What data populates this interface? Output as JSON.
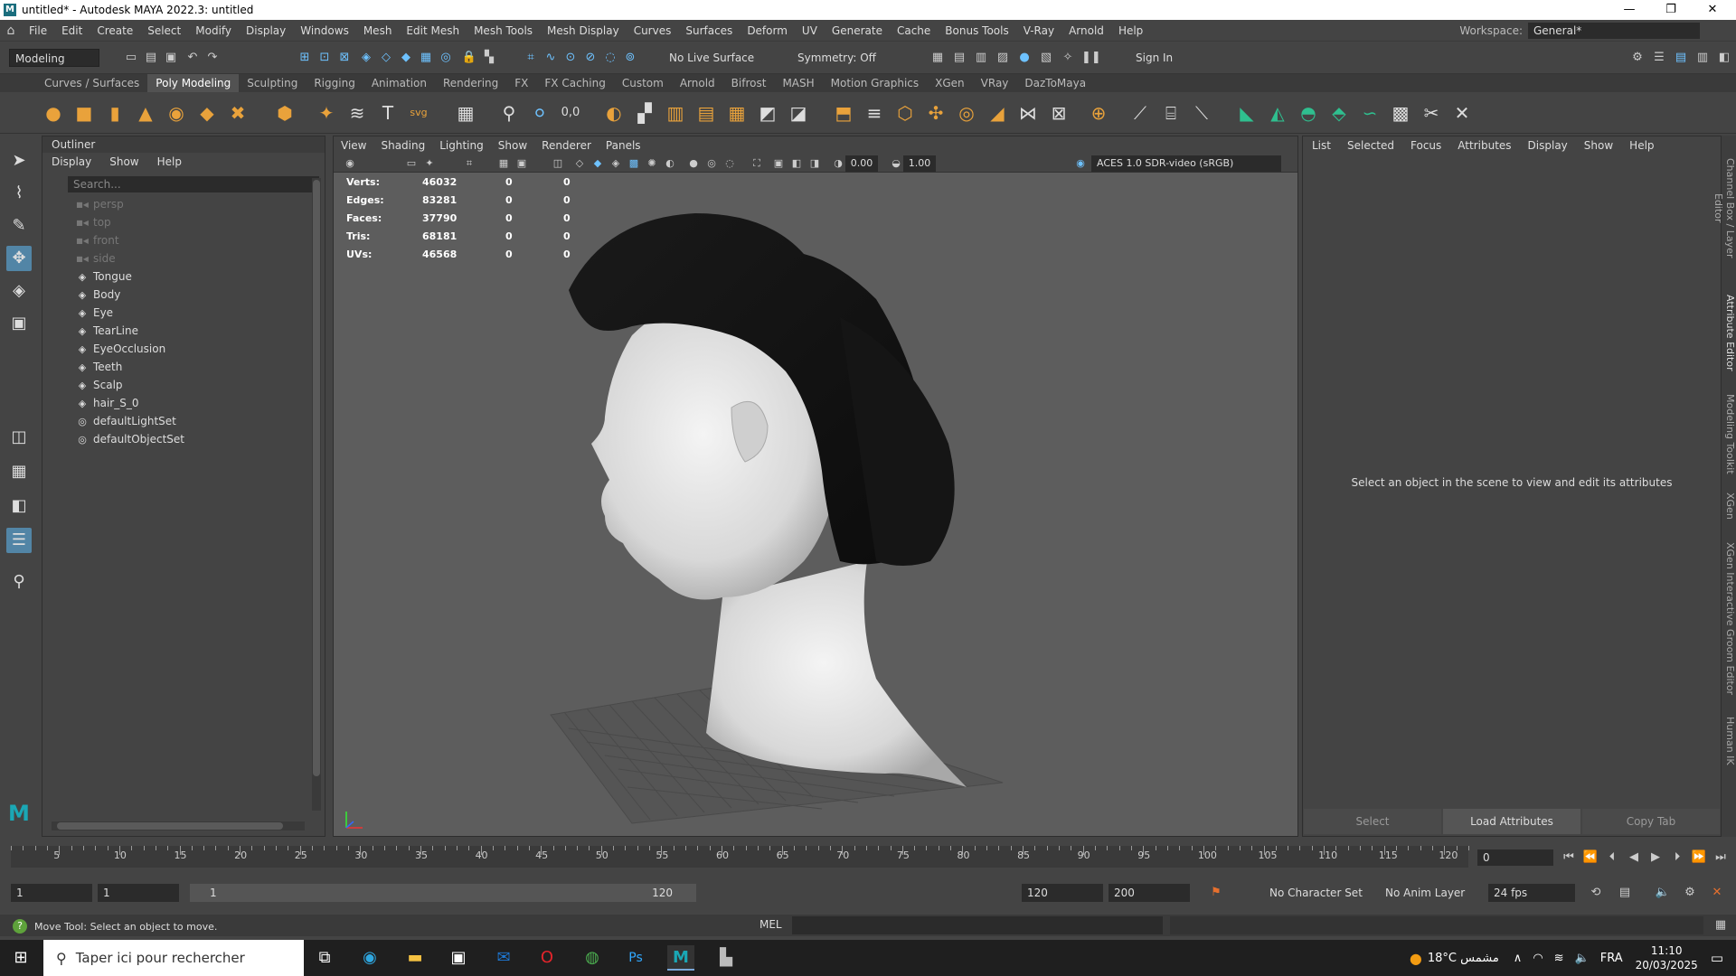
{
  "window": {
    "title": "untitled* - Autodesk MAYA 2022.3: untitled",
    "minimize": "—",
    "restore": "❐",
    "close": "✕"
  },
  "menu": [
    "File",
    "Edit",
    "Create",
    "Select",
    "Modify",
    "Display",
    "Windows",
    "Mesh",
    "Edit Mesh",
    "Mesh Tools",
    "Mesh Display",
    "Curves",
    "Surfaces",
    "Deform",
    "UV",
    "Generate",
    "Cache",
    "Bonus Tools",
    "V-Ray",
    "Arnold",
    "Help"
  ],
  "workspace": {
    "label": "Workspace:",
    "value": "General*"
  },
  "statusline": {
    "menuset": "Modeling",
    "live_surface": "No Live Surface",
    "symmetry": "Symmetry: Off",
    "sign_in": "Sign In"
  },
  "shelf_tabs": [
    "Curves / Surfaces",
    "Poly Modeling",
    "Sculpting",
    "Rigging",
    "Animation",
    "Rendering",
    "FX",
    "FX Caching",
    "Custom",
    "Arnold",
    "Bifrost",
    "MASH",
    "Motion Graphics",
    "XGen",
    "VRay",
    "DazToMaya"
  ],
  "shelf_active": "Poly Modeling",
  "outliner": {
    "title": "Outliner",
    "menu": [
      "Display",
      "Show",
      "Help"
    ],
    "search_placeholder": "Search...",
    "items": [
      {
        "label": "persp",
        "icon": "camera-icon",
        "dim": true
      },
      {
        "label": "top",
        "icon": "camera-icon",
        "dim": true
      },
      {
        "label": "front",
        "icon": "camera-icon",
        "dim": true
      },
      {
        "label": "side",
        "icon": "camera-icon",
        "dim": true
      },
      {
        "label": "Tongue",
        "icon": "mesh-icon",
        "dim": false
      },
      {
        "label": "Body",
        "icon": "mesh-icon",
        "dim": false
      },
      {
        "label": "Eye",
        "icon": "mesh-icon",
        "dim": false
      },
      {
        "label": "TearLine",
        "icon": "mesh-icon",
        "dim": false
      },
      {
        "label": "EyeOcclusion",
        "icon": "mesh-icon",
        "dim": false
      },
      {
        "label": "Teeth",
        "icon": "mesh-icon",
        "dim": false
      },
      {
        "label": "Scalp",
        "icon": "mesh-icon",
        "dim": false
      },
      {
        "label": "hair_S_0",
        "icon": "mesh-icon",
        "dim": false
      },
      {
        "label": "defaultLightSet",
        "icon": "set-icon",
        "dim": false
      },
      {
        "label": "defaultObjectSet",
        "icon": "set-icon",
        "dim": false
      }
    ]
  },
  "viewport": {
    "menu": [
      "View",
      "Shading",
      "Lighting",
      "Show",
      "Renderer",
      "Panels"
    ],
    "exposure": "0.00",
    "gamma": "1.00",
    "colorspace": "ACES 1.0 SDR-video (sRGB)",
    "hud": [
      {
        "label": "Verts:",
        "a": "46032",
        "b": "0",
        "c": "0"
      },
      {
        "label": "Edges:",
        "a": "83281",
        "b": "0",
        "c": "0"
      },
      {
        "label": "Faces:",
        "a": "37790",
        "b": "0",
        "c": "0"
      },
      {
        "label": "Tris:",
        "a": "68181",
        "b": "0",
        "c": "0"
      },
      {
        "label": "UVs:",
        "a": "46568",
        "b": "0",
        "c": "0"
      }
    ]
  },
  "attribute_editor": {
    "menu": [
      "List",
      "Selected",
      "Focus",
      "Attributes",
      "Display",
      "Show",
      "Help"
    ],
    "message": "Select an object in the scene to view and edit its attributes",
    "buttons": [
      "Select",
      "Load Attributes",
      "Copy Tab"
    ]
  },
  "side_tabs": [
    "Channel Box / Layer Editor",
    "Attribute Editor",
    "Modeling Toolkit",
    "XGen",
    "XGen Interactive Groom Editor",
    "Human IK"
  ],
  "timeline": {
    "ticks": [
      5,
      10,
      15,
      20,
      25,
      30,
      35,
      40,
      45,
      50,
      55,
      60,
      65,
      70,
      75,
      80,
      85,
      90,
      95,
      100,
      105,
      110,
      115,
      120
    ],
    "current_frame": "0"
  },
  "range": {
    "start": "1",
    "start2": "1",
    "slider_start": "1",
    "slider_end": "120",
    "end": "120",
    "end2": "200",
    "character_set": "No Character Set",
    "anim_layer": "No Anim Layer",
    "fps": "24 fps"
  },
  "cmdline": {
    "help": "Move Tool: Select an object to move.",
    "lang": "MEL"
  },
  "taskbar": {
    "search": "Taper ici pour rechercher",
    "weather": "18°C  مشمس",
    "lang": "FRA",
    "time": "11:10",
    "date": "20/03/2025"
  }
}
